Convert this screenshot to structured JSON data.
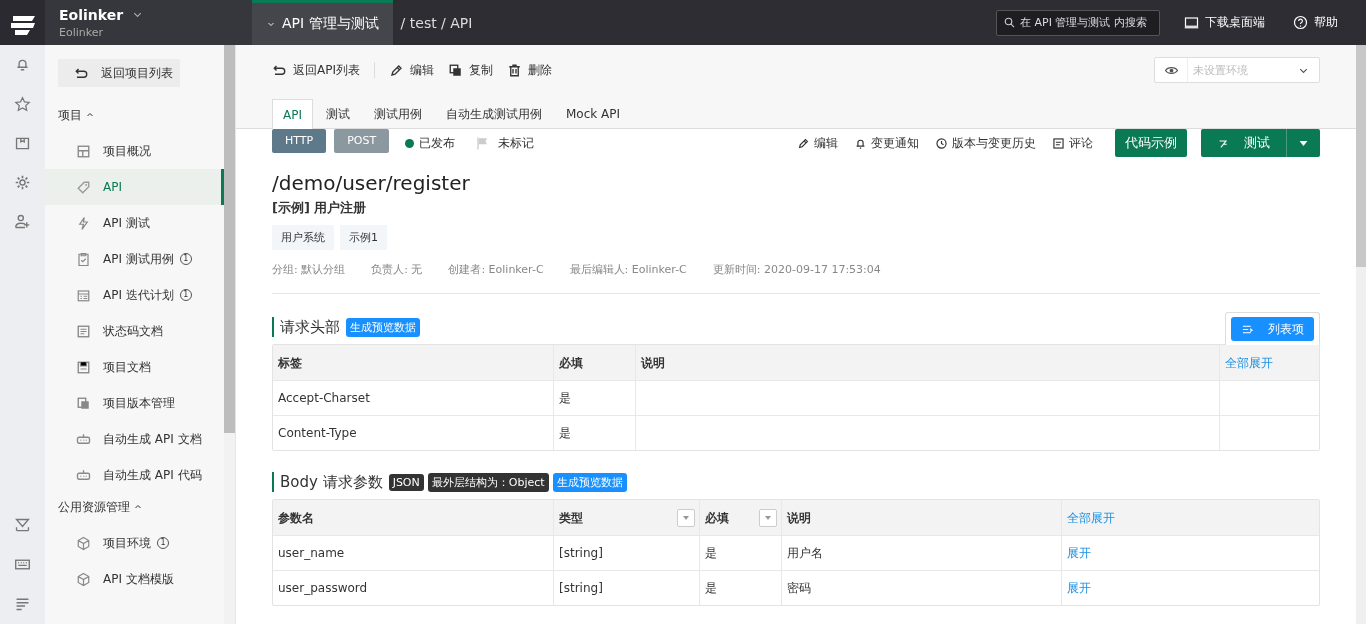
{
  "topbar": {
    "brand": "Eolinker",
    "workspace": "Eolinker",
    "module": "API 管理与测试",
    "breadcrumb": "/ test / API",
    "search": {
      "placeholder": "在 API 管理与测试 内搜索"
    },
    "links": [
      "下载桌面端",
      "帮助"
    ]
  },
  "sidebar": {
    "back": "返回项目列表",
    "groups": [
      {
        "title": "项目",
        "expanded": true,
        "items": [
          {
            "label": "项目概况",
            "selected": false
          },
          {
            "label": "API",
            "selected": true
          },
          {
            "label": "API 测试",
            "selected": false
          },
          {
            "label": "API 测试用例",
            "count": "1",
            "selected": false
          },
          {
            "label": "API 迭代计划",
            "count": "1",
            "selected": false
          },
          {
            "label": "状态码文档",
            "selected": false
          },
          {
            "label": "项目文档",
            "selected": false
          },
          {
            "label": "项目版本管理",
            "selected": false
          },
          {
            "label": "自动生成 API 文档",
            "selected": false
          },
          {
            "label": "自动生成 API 代码",
            "selected": false
          }
        ]
      },
      {
        "title": "公用资源管理",
        "expanded": true,
        "items": [
          {
            "label": "项目环境",
            "count": "1",
            "selected": false
          },
          {
            "label": "API 文档模版",
            "selected": false
          }
        ]
      }
    ]
  },
  "toolbar": {
    "actions": [
      "返回API列表",
      "编辑",
      "复制",
      "删除"
    ],
    "environment": {
      "placeholder": "未设置环境"
    }
  },
  "tabs": [
    {
      "label": "API",
      "selected": true
    },
    {
      "label": "测试",
      "selected": false
    },
    {
      "label": "测试用例",
      "selected": false
    },
    {
      "label": "自动生成测试用例",
      "selected": false
    },
    {
      "label": "Mock API",
      "selected": false
    }
  ],
  "api": {
    "protocol": "HTTP",
    "method": "POST",
    "status": {
      "label": "已发布",
      "color": "#0a7a55"
    },
    "mark": {
      "label": "未标记",
      "flagged": false
    },
    "actions": [
      "编辑",
      "变更通知",
      "版本与变更历史",
      "评论"
    ],
    "code_button": "代码示例",
    "test_button": "测试",
    "path": "/demo/user/register",
    "name": "[示例] 用户注册",
    "tags": [
      "用户系统",
      "示例1"
    ],
    "meta": [
      "分组: 默认分组",
      "负责人: 无",
      "创建者: Eolinker-C",
      "最后编辑人: Eolinker-C",
      "更新时间:  2020-09-17 17:53:04"
    ]
  },
  "sections": [
    {
      "kind": "headers",
      "title": "请求头部",
      "badges": [
        {
          "text": "生成预览数据",
          "kind": "action"
        }
      ],
      "list_button": "列表项",
      "columns": [
        {
          "label": "标签"
        },
        {
          "label": "必填"
        },
        {
          "label": "说明"
        },
        {
          "label": "全部展开",
          "kind": "link"
        }
      ],
      "rows": [
        {
          "cells": [
            "Accept-Charset",
            "是"
          ]
        },
        {
          "cells": [
            "Content-Type",
            "是"
          ]
        }
      ]
    },
    {
      "kind": "body",
      "title": "Body 请求参数",
      "badges": [
        {
          "text": "JSON",
          "kind": "info"
        },
        {
          "text": "最外层结构为：Object",
          "kind": "info"
        },
        {
          "text": "生成预览数据",
          "kind": "action"
        }
      ],
      "columns": [
        {
          "label": "参数名"
        },
        {
          "label": "类型",
          "filter": true
        },
        {
          "label": "必填",
          "filter": true
        },
        {
          "label": "说明"
        },
        {
          "label": "全部展开",
          "kind": "link"
        }
      ],
      "rows": [
        {
          "cells": [
            "user_name",
            "[string]",
            "是",
            "用户名",
            "展开"
          ]
        },
        {
          "cells": [
            "user_password",
            "[string]",
            "是",
            "密码",
            "展开"
          ]
        }
      ]
    }
  ]
}
